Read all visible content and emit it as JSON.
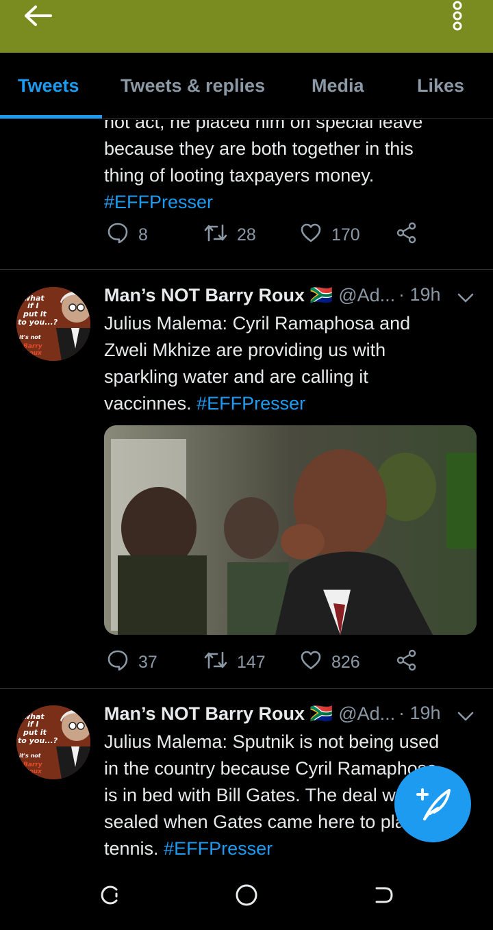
{
  "appbar": {
    "back_icon": "arrow-left-icon",
    "more_icon": "more-vertical-icon",
    "color": "#7a8c1f"
  },
  "tabs": [
    {
      "label": "Tweets",
      "active": true
    },
    {
      "label": "Tweets & replies",
      "active": false
    },
    {
      "label": "Media",
      "active": false
    },
    {
      "label": "Likes",
      "active": false
    }
  ],
  "tweets": [
    {
      "text_lines": [
        "not act, he placed him on special leave",
        "because they are both together in this",
        "thing of looting taxpayers money."
      ],
      "hashtag": "#EFFPresser",
      "replies": "8",
      "retweets": "28",
      "likes": "170"
    },
    {
      "name": "Man’s NOT Barry Roux 🇿🇦",
      "handle": "@Ad...",
      "time": "· 19h",
      "avatar_text": [
        "what",
        "if I",
        "put it",
        "to you...?",
        "it's not",
        "Barry",
        "Roux"
      ],
      "text_lines": [
        "Julius Malema: Cyril Ramaphosa and",
        "Zweli Mkhize are providing us with",
        "sparkling water and are calling it"
      ],
      "last_line": "vaccinnes.",
      "hashtag": "#EFFPresser",
      "replies": "37",
      "retweets": "147",
      "likes": "826"
    },
    {
      "name": "Man’s NOT Barry Roux 🇿🇦",
      "handle": "@Ad...",
      "time": "· 19h",
      "avatar_text": [
        "what",
        "if I",
        "put it",
        "to you...?",
        "it's not",
        "Barry",
        "Roux"
      ],
      "text_lines": [
        "Julius Malema: Sputnik is not being used",
        "in the country because Cyril Ramaphosa",
        "is in bed with Bill Gates. The deal was",
        "sealed when Gates came here to play"
      ],
      "last_line": "tennis.",
      "hashtag": "#EFFPresser"
    }
  ],
  "fab": {
    "icon": "compose-feather-icon"
  },
  "navbar": {
    "icons": [
      "recent-apps-icon",
      "home-circle-icon",
      "back-nav-icon"
    ]
  },
  "colors": {
    "accent": "#1d9bf0",
    "text": "#e7e9ea",
    "secondary": "#8b98a5",
    "divider": "#2f3336"
  }
}
